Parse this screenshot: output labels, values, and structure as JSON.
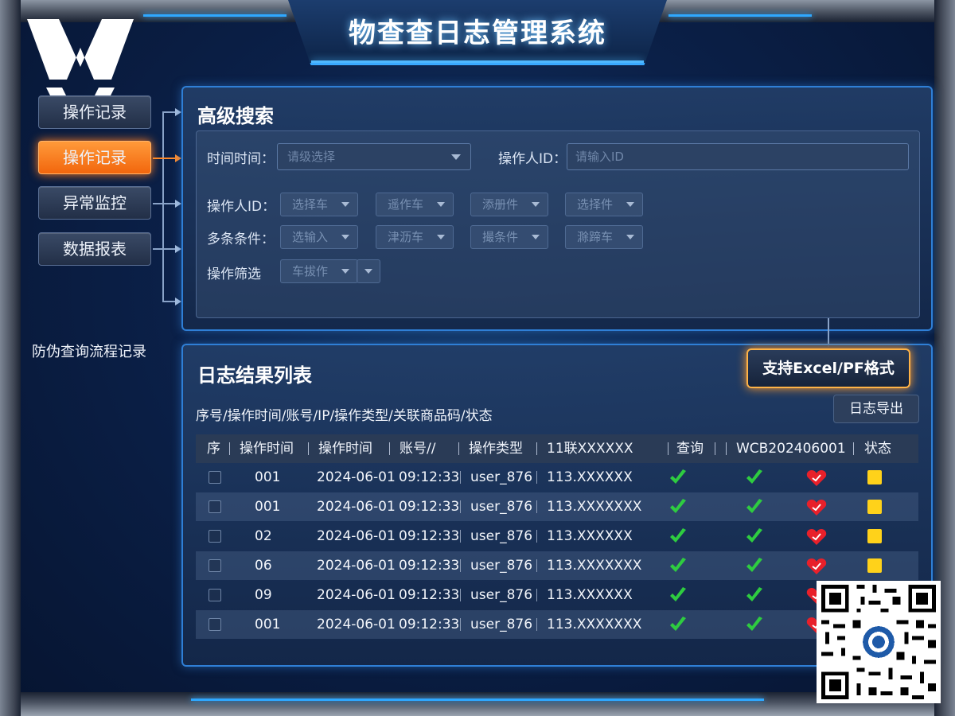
{
  "app": {
    "title": "物查查日志管理系统"
  },
  "sidebar": {
    "items": [
      {
        "label": "操作记录",
        "active": false
      },
      {
        "label": "操作记录",
        "active": true
      },
      {
        "label": "异常监控",
        "active": false
      },
      {
        "label": "数据报表",
        "active": false
      }
    ],
    "caption": "防伪查询流程记录"
  },
  "search": {
    "title": "高级搜索",
    "time_label": "时间时间：",
    "time_placeholder": "请级选择",
    "operator_label": "操作人ID：",
    "operator_placeholder": "请输入ID",
    "rows": [
      {
        "label": "操作人ID：",
        "chips": [
          "选择车",
          "遥作车",
          "添册件",
          "选择件"
        ]
      },
      {
        "label": "多条条件：",
        "chips": [
          "选输入",
          "津沥车",
          "撮条件",
          "滁蹄车"
        ]
      },
      {
        "label": "操作筛选",
        "chips": [
          "车拔作"
        ]
      }
    ]
  },
  "results": {
    "title": "日志结果列表",
    "excel_button": "支持Excel/PF格式",
    "export_button": "日志导出",
    "fields_line": "序号/操作时间/账号/IP/操作类型/关联商品码/状态",
    "columns": [
      "序",
      "操作时间",
      "操作时间",
      "账号//",
      "操作类型",
      "11联XXXXXX",
      "查询",
      "WCB202406001",
      "状态"
    ],
    "rows": [
      {
        "seq": "001",
        "date": "2024-06-01",
        "time": "09:12:33",
        "account": "user_876",
        "ip": "113.XXXXXX"
      },
      {
        "seq": "001",
        "date": "2024-06-01",
        "time": "09:12:33",
        "account": "user_876",
        "ip": "113.XXXXXXX"
      },
      {
        "seq": "02",
        "date": "2024-06-01",
        "time": "09:12:33",
        "account": "user_876",
        "ip": "113.XXXXXX"
      },
      {
        "seq": "06",
        "date": "2024-06-01",
        "time": "09:12:33",
        "account": "user_876",
        "ip": "113.XXXXXXX"
      },
      {
        "seq": "09",
        "date": "2024-06-01",
        "time": "09:12:33",
        "account": "user_876",
        "ip": "113.XXXXXX"
      },
      {
        "seq": "001",
        "date": "2024-06-01",
        "time": "09:12:33",
        "account": "user_876",
        "ip": "113.XXXXXXX"
      }
    ]
  },
  "colors": {
    "accent_blue": "#2f7fd6",
    "active_orange": "#f2660d",
    "check_green": "#2ecc40",
    "heart_red": "#e8202a",
    "status_yellow": "#ffd21a"
  },
  "icons": [
    "logo-icon",
    "caret-down-icon",
    "check-icon",
    "heart-icon",
    "status-square-icon",
    "qr-code"
  ]
}
